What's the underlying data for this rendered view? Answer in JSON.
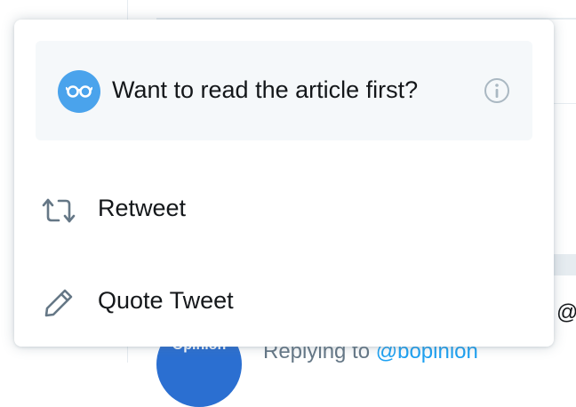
{
  "background": {
    "at_sign": "@",
    "avatar_text": "Opinion",
    "replying_prefix": "Replying to",
    "replying_handle": "@bopinion"
  },
  "menu": {
    "prompt": {
      "text": "Want to read the article first?",
      "icon": "glasses-icon",
      "info_icon": "info-icon",
      "icon_bg_color": "#4aa3ec",
      "card_bg_color": "#f5f8fa"
    },
    "items": [
      {
        "label": "Retweet",
        "icon": "retweet-icon"
      },
      {
        "label": "Quote Tweet",
        "icon": "pencil-icon"
      }
    ]
  },
  "colors": {
    "text": "#14171a",
    "muted": "#657786",
    "link": "#1da1f2"
  }
}
